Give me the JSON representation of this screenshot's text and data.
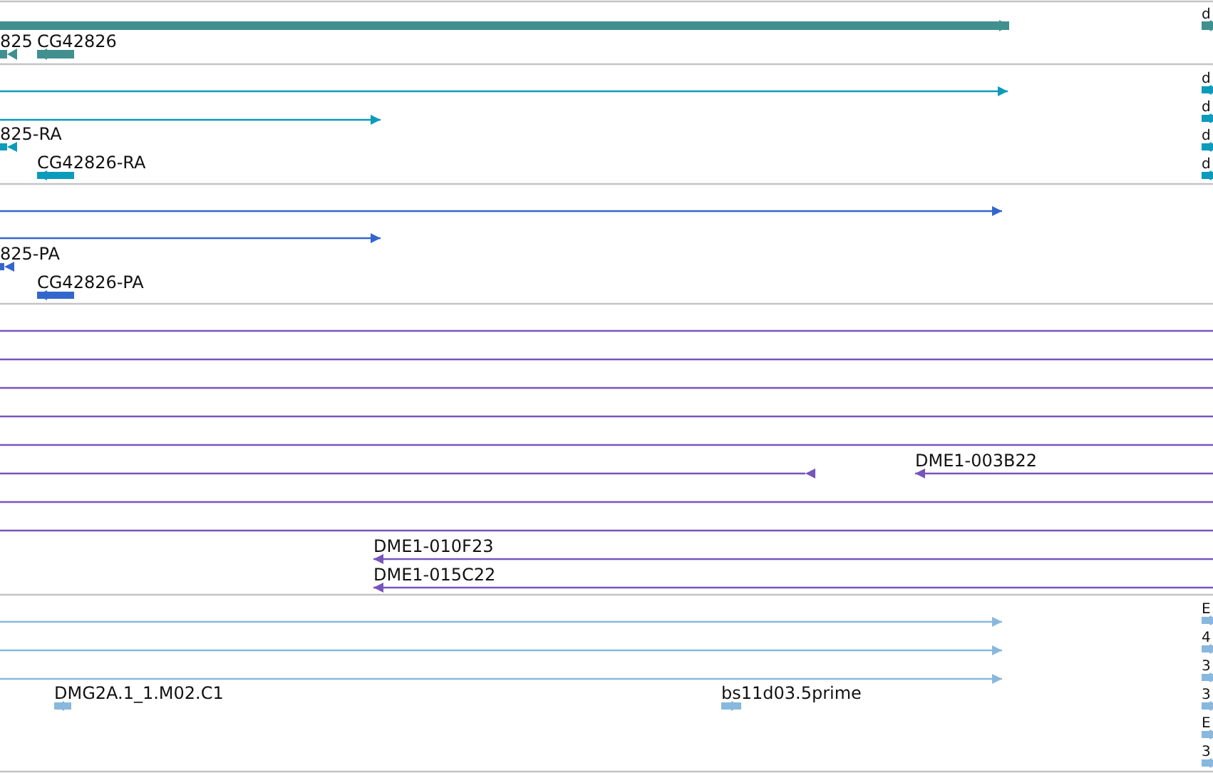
{
  "tracks": [
    {
      "kind": "gene",
      "color": "#418f8f",
      "features": [
        {
          "kind": "forward"
        },
        {
          "label": "825",
          "kind": "reverse"
        },
        {
          "label": "CG42826",
          "kind": "reverse"
        },
        {
          "label": "d",
          "kind": "reverse"
        }
      ]
    },
    {
      "kind": "transcript",
      "color": "#0b9bbb",
      "features": [
        {
          "kind": "forward"
        },
        {
          "kind": "forward"
        },
        {
          "label": "825-RA",
          "kind": "reverse"
        },
        {
          "label": "CG42826-RA",
          "kind": "reverse"
        },
        {
          "label": "d",
          "kind": "reverse"
        },
        {
          "label": "d",
          "kind": "reverse"
        },
        {
          "label": "d",
          "kind": "reverse"
        },
        {
          "label": "d",
          "kind": "reverse"
        }
      ]
    },
    {
      "kind": "transcript",
      "color": "#3366cc",
      "features": [
        {
          "kind": "forward"
        },
        {
          "kind": "forward"
        },
        {
          "label": "825-PA",
          "kind": "reverse"
        },
        {
          "label": "CG42826-PA",
          "kind": "reverse"
        }
      ]
    },
    {
      "kind": "clone",
      "color": "#7755bb",
      "features": [
        {
          "kind": "plain"
        },
        {
          "kind": "plain"
        },
        {
          "kind": "plain"
        },
        {
          "kind": "plain"
        },
        {
          "kind": "plain"
        },
        {
          "kind": "reverse"
        },
        {
          "label": "DME1-003B22",
          "kind": "reverse"
        },
        {
          "kind": "plain"
        },
        {
          "kind": "plain"
        },
        {
          "label": "DME1-010F23",
          "kind": "reverse"
        },
        {
          "label": "DME1-015C22",
          "kind": "reverse"
        }
      ]
    },
    {
      "kind": "clone",
      "color": "#88b8dd",
      "features": [
        {
          "kind": "forward"
        },
        {
          "kind": "forward"
        },
        {
          "kind": "forward"
        },
        {
          "label": "DMG2A.1_1.M02.C1",
          "kind": "reverse"
        },
        {
          "label": "bs11d03.5prime",
          "kind": "forward"
        },
        {
          "label": "E",
          "kind": "reverse"
        },
        {
          "label": "4",
          "kind": "reverse"
        },
        {
          "label": "3",
          "kind": "reverse"
        },
        {
          "label": "3",
          "kind": "reverse"
        },
        {
          "label": "E",
          "kind": "reverse"
        },
        {
          "label": "3",
          "kind": "reverse"
        }
      ]
    }
  ]
}
